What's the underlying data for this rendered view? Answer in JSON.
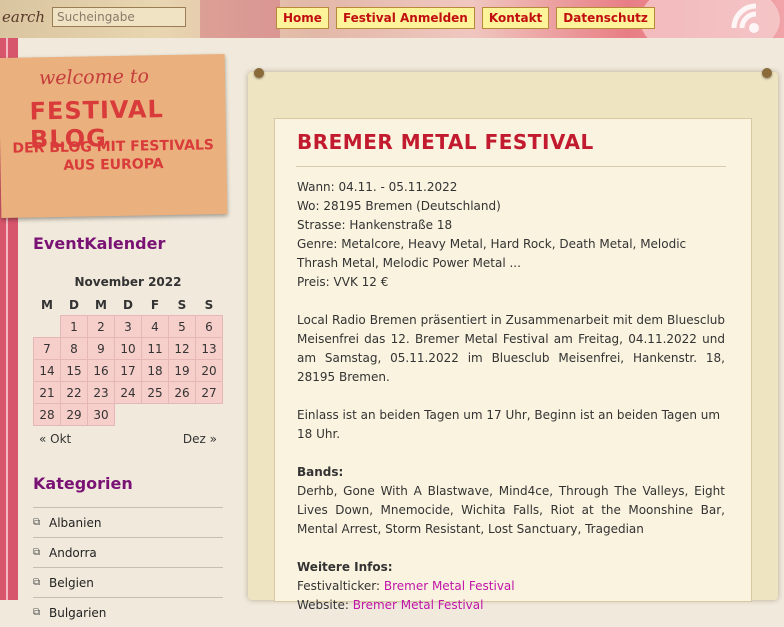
{
  "search": {
    "label": "earch",
    "placeholder": "Sucheingabe"
  },
  "nav": [
    "Home",
    "Festival Anmelden",
    "Kontakt",
    "Datenschutz"
  ],
  "logo": {
    "welcome": "welcome to",
    "title": "FESTIVAL BLOG",
    "subtitle_1": "DER BLOG MIT FESTIVALS",
    "subtitle_2": "AUS EUROPA"
  },
  "sidebar": {
    "calendar_heading": "EventKalender",
    "calendar_caption": "November 2022",
    "weekdays": [
      "M",
      "D",
      "M",
      "D",
      "F",
      "S",
      "S"
    ],
    "weeks": [
      [
        "",
        "1",
        "2",
        "3",
        "4",
        "5",
        "6"
      ],
      [
        "7",
        "8",
        "9",
        "10",
        "11",
        "12",
        "13"
      ],
      [
        "14",
        "15",
        "16",
        "17",
        "18",
        "19",
        "20"
      ],
      [
        "21",
        "22",
        "23",
        "24",
        "25",
        "26",
        "27"
      ],
      [
        "28",
        "29",
        "30",
        "",
        "",
        "",
        ""
      ]
    ],
    "prev": "« Okt",
    "next": "Dez »",
    "categories_heading": "Kategorien",
    "categories": [
      "Albanien",
      "Andorra",
      "Belgien",
      "Bulgarien"
    ]
  },
  "post": {
    "title": "BREMER METAL FESTIVAL",
    "wann": "Wann: 04.11. - 05.11.2022",
    "wo": "Wo: 28195 Bremen (Deutschland)",
    "strasse": "Strasse: Hankenstraße 18",
    "genre": "Genre: Metalcore, Heavy Metal, Hard Rock, Death Metal, Melodic Thrash Metal, Melodic Power Metal ...",
    "preis": "Preis: VVK 12 €",
    "intro": "Local Radio Bremen präsentiert in Zusammenarbeit mit dem Bluesclub Meisenfrei das 12. Bremer Metal Festival am Freitag, 04.11.2022 und am Samstag, 05.11.2022 im Bluesclub Meisenfrei, Hankenstr. 18, 28195 Bremen.",
    "einlass": "Einlass ist an beiden Tagen um 17 Uhr, Beginn ist an beiden Tagen um 18 Uhr.",
    "bands_label": "Bands:",
    "bands": "Derhb, Gone With A Blastwave, Mind4ce, Through The Valleys, Eight Lives Down, Mnemocide, Wichita Falls, Riot at the Moonshine Bar, Mental Arrest, Storm Resistant, Lost Sanctuary, Tragedian",
    "infos_label": "Weitere Infos:",
    "ticker_label": "Festivalticker: ",
    "ticker_link": "Bremer Metal Festival",
    "website_label": "Website: ",
    "website_link": "Bremer Metal Festival"
  }
}
